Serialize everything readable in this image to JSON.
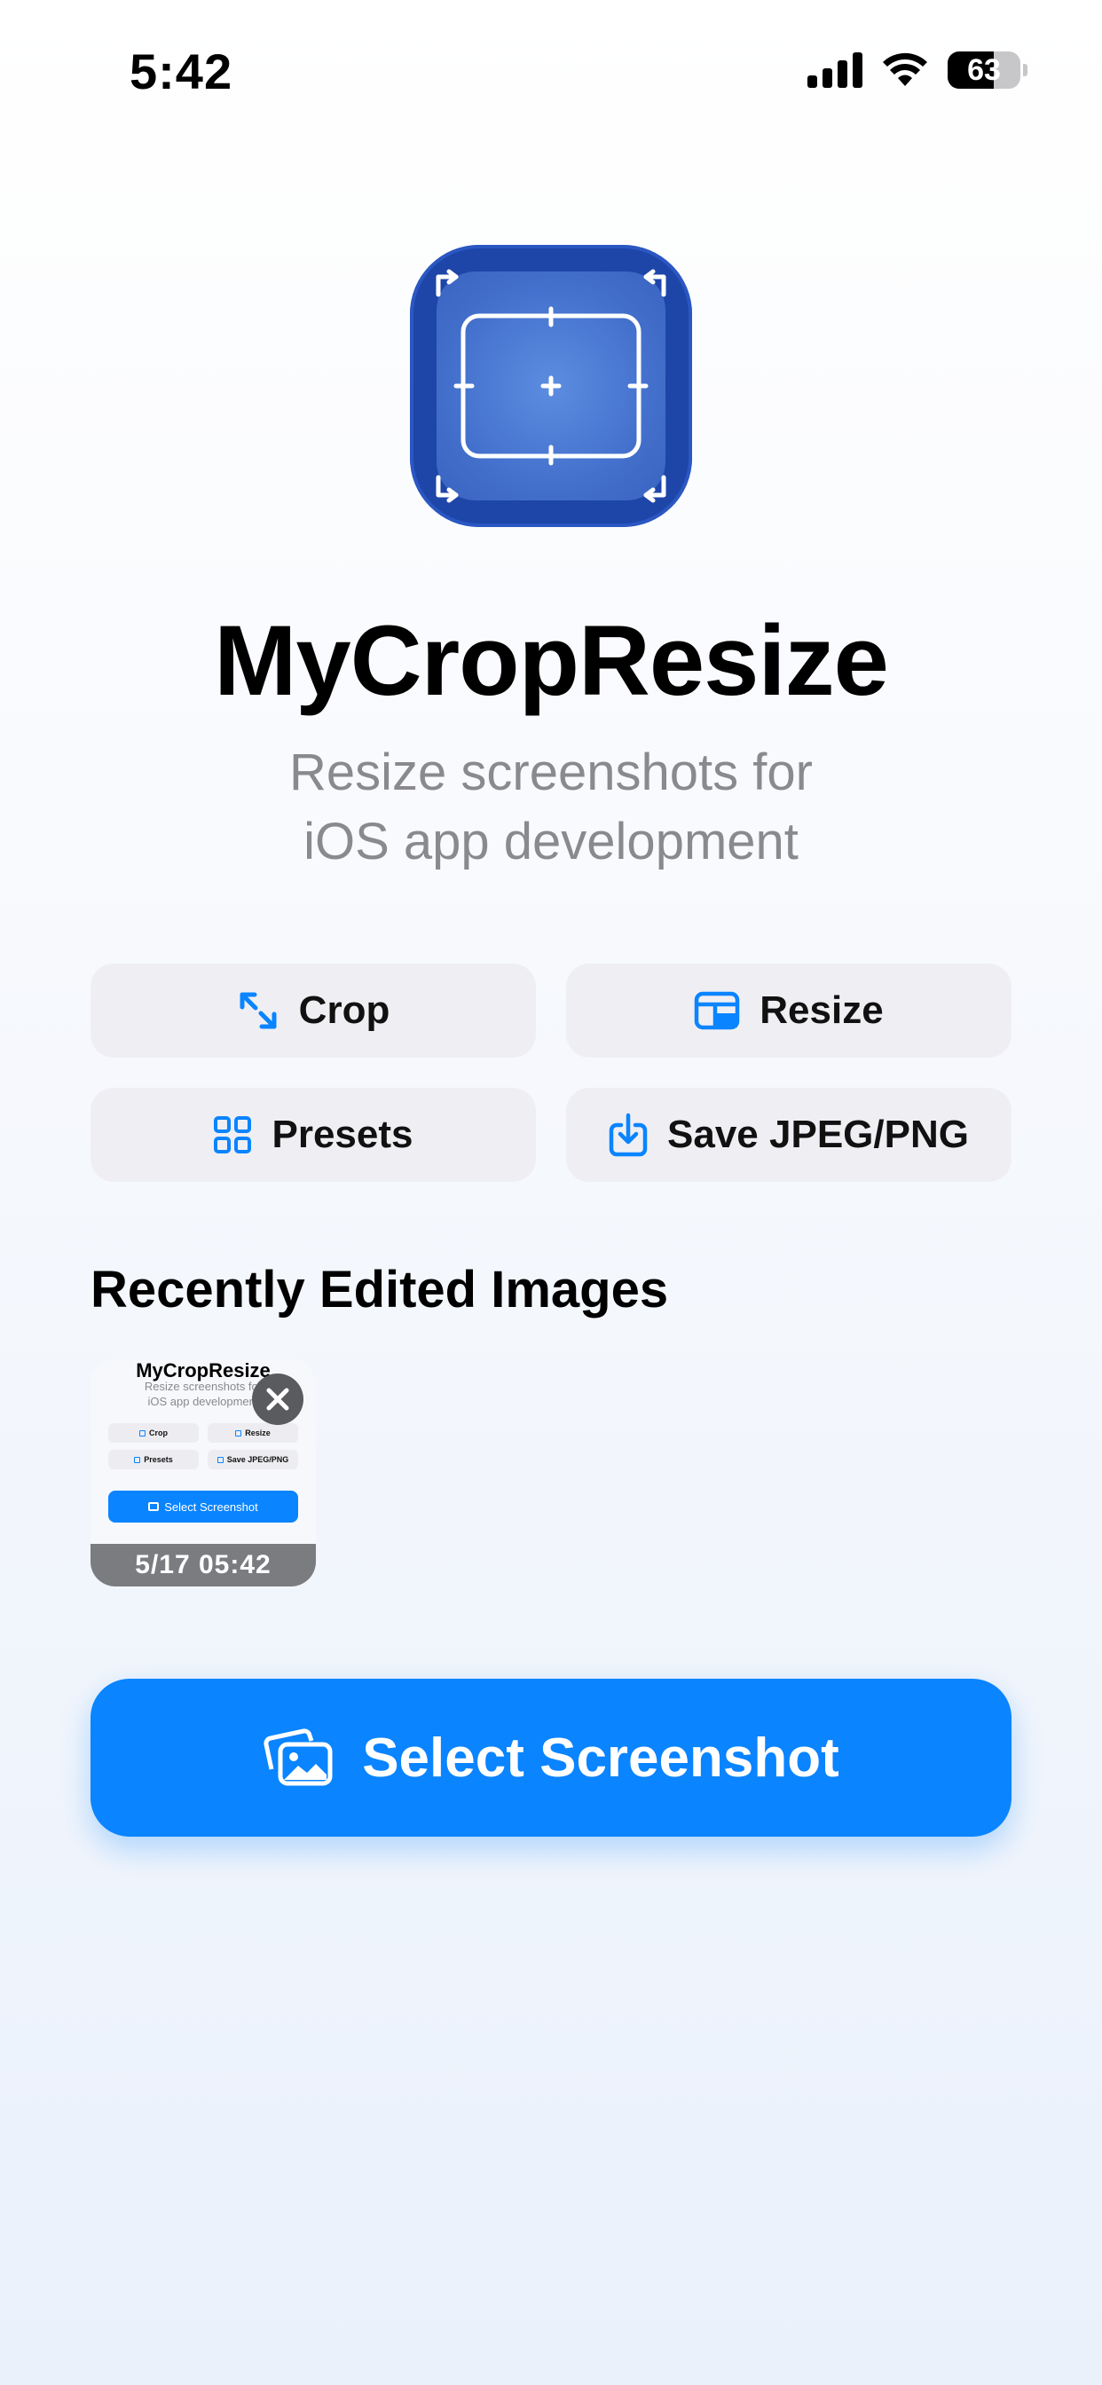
{
  "status_bar": {
    "time": "5:42",
    "battery_percent": "63",
    "battery_level": 0.63
  },
  "app": {
    "title": "MyCropResize",
    "subtitle_line1": "Resize screenshots for",
    "subtitle_line2": "iOS app development"
  },
  "features": {
    "crop": "Crop",
    "resize": "Resize",
    "presets": "Presets",
    "save": "Save JPEG/PNG"
  },
  "recent": {
    "title": "Recently Edited Images",
    "items": [
      {
        "date": "5/17 05:42",
        "preview_title": "MyCropResize",
        "preview_sub1": "Resize screenshots for",
        "preview_sub2": "iOS app development",
        "preview_crop": "Crop",
        "preview_resize": "Resize",
        "preview_presets": "Presets",
        "preview_save": "Save JPEG/PNG",
        "preview_select": "Select Screenshot"
      }
    ]
  },
  "primary_action": {
    "label": "Select Screenshot"
  },
  "colors": {
    "accent": "#0a84ff",
    "icon_dark": "#1e45a8",
    "icon_light": "#4a7bd6"
  }
}
